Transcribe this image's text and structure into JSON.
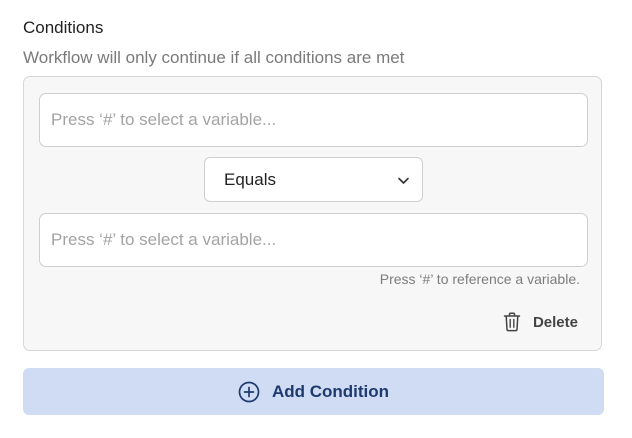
{
  "section": {
    "title": "Conditions",
    "subtitle": "Workflow will only continue if all conditions are met"
  },
  "condition": {
    "left_operand": {
      "value": "",
      "placeholder": "Press ‘#’ to select a variable..."
    },
    "operator": {
      "selected": "Equals",
      "icon": "chevron-down-icon"
    },
    "right_operand": {
      "value": "",
      "placeholder": "Press ‘#’ to select a variable..."
    },
    "hint": "Press ‘#’ to reference a variable.",
    "delete": {
      "label": "Delete",
      "icon": "trash-icon"
    }
  },
  "add_condition": {
    "label": "Add Condition",
    "icon": "plus-circle-icon"
  },
  "colors": {
    "panel_background": "#f7f7f7",
    "panel_border": "#d6d6d6",
    "add_button_background": "#cfdcf3",
    "add_button_text": "#1e3a6e"
  }
}
